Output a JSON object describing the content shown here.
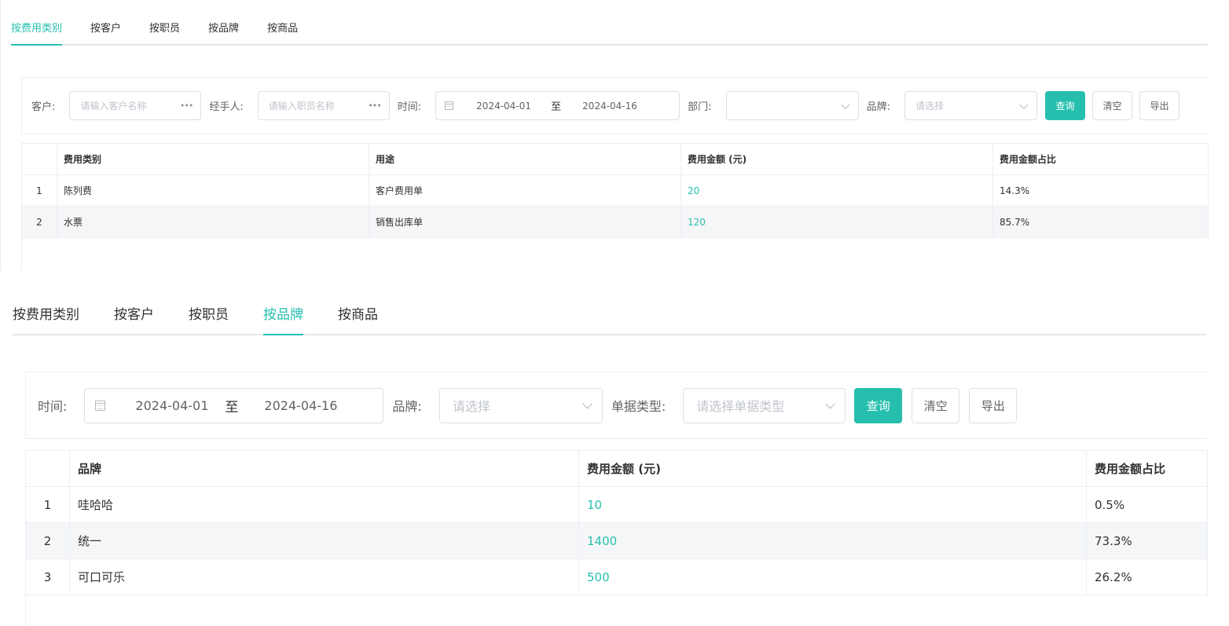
{
  "colors": {
    "accent": "#26bfae",
    "border": "#dcdfe6",
    "placeholder": "#c0c4cc",
    "stripe": "#f5f6f7"
  },
  "top_panel": {
    "tabs": [
      {
        "label": "按费用类别",
        "active": true
      },
      {
        "label": "按客户",
        "active": false
      },
      {
        "label": "按职员",
        "active": false
      },
      {
        "label": "按品牌",
        "active": false
      },
      {
        "label": "按商品",
        "active": false
      }
    ],
    "filters": {
      "customer_label": "客户:",
      "customer_placeholder": "请输入客户名称",
      "handler_label": "经手人:",
      "handler_placeholder": "请输入职员名称",
      "time_label": "时间:",
      "date_start": "2024-04-01",
      "date_sep": "至",
      "date_end": "2024-04-16",
      "dept_label": "部门:",
      "brand_label": "品牌:",
      "brand_placeholder": "请选择",
      "query_label": "查询",
      "clear_label": "清空",
      "export_label": "导出"
    },
    "table": {
      "headers": [
        "",
        "费用类别",
        "用途",
        "费用金额 (元)",
        "费用金额占比"
      ],
      "rows": [
        {
          "index": "1",
          "category": "陈列费",
          "usage": "客户费用单",
          "amount": "20",
          "ratio": "14.3%"
        },
        {
          "index": "2",
          "category": "水票",
          "usage": "销售出库单",
          "amount": "120",
          "ratio": "85.7%"
        }
      ]
    }
  },
  "bottom_panel": {
    "tabs": [
      {
        "label": "按费用类别",
        "active": false
      },
      {
        "label": "按客户",
        "active": false
      },
      {
        "label": "按职员",
        "active": false
      },
      {
        "label": "按品牌",
        "active": true
      },
      {
        "label": "按商品",
        "active": false
      }
    ],
    "filters": {
      "time_label": "时间:",
      "date_start": "2024-04-01",
      "date_sep": "至",
      "date_end": "2024-04-16",
      "brand_label": "品牌:",
      "brand_placeholder": "请选择",
      "doc_type_label": "单据类型:",
      "doc_type_placeholder": "请选择单据类型",
      "query_label": "查询",
      "clear_label": "清空",
      "export_label": "导出"
    },
    "table": {
      "headers": [
        "",
        "品牌",
        "费用金额 (元)",
        "费用金额占比"
      ],
      "rows": [
        {
          "index": "1",
          "brand": "哇哈哈",
          "amount": "10",
          "ratio": "0.5%"
        },
        {
          "index": "2",
          "brand": "统一",
          "amount": "1400",
          "ratio": "73.3%"
        },
        {
          "index": "3",
          "brand": "可口可乐",
          "amount": "500",
          "ratio": "26.2%"
        }
      ]
    }
  }
}
